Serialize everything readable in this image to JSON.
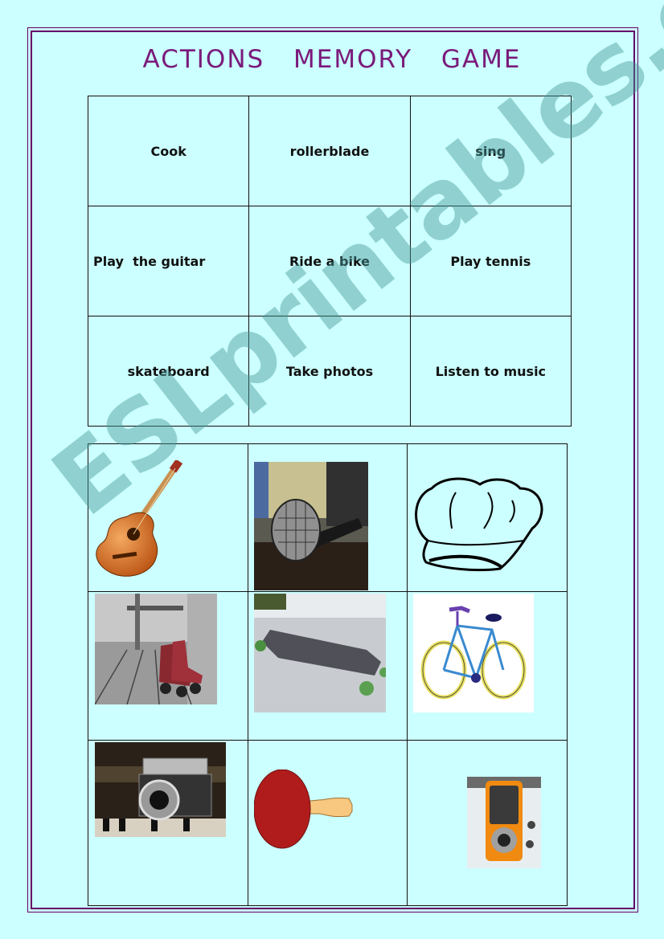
{
  "title": "ACTIONS    MEMORY    GAME",
  "colors": {
    "background": "#ccffff",
    "title": "#7a1a7a",
    "frame": "#660066",
    "watermark": "#5aa0a0"
  },
  "word_cards": [
    [
      "Cook",
      "rollerblade",
      "sing"
    ],
    [
      "Play  the guitar",
      "Ride a bike",
      "Play tennis"
    ],
    [
      "skateboard",
      "Take photos",
      "Listen to music"
    ]
  ],
  "picture_cards": [
    [
      "guitar-image",
      "microphone-image",
      "chef-hat-image"
    ],
    [
      "roller-skates-image",
      "skateboard-image",
      "bicycle-image"
    ],
    [
      "camera-image",
      "ping-pong-paddle-image",
      "mp3-player-image"
    ]
  ],
  "watermark": "ESLprintables.com"
}
